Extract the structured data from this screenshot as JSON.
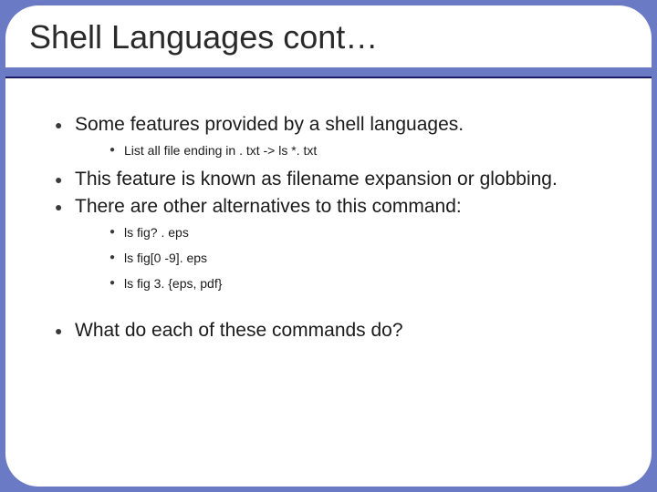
{
  "slide": {
    "title": "Shell Languages cont…",
    "items": {
      "p1": "Some features provided by a shell languages.",
      "p1_sub1": "List all file ending in . txt -> ls *. txt",
      "p2": "This feature is known as filename expansion or globbing.",
      "p3": "There are other alternatives to this command:",
      "p3_sub1": "ls fig? . eps",
      "p3_sub2": "ls fig[0 -9]. eps",
      "p3_sub3": "ls fig 3. {eps, pdf}",
      "p4": "What do each of these commands do?"
    }
  }
}
